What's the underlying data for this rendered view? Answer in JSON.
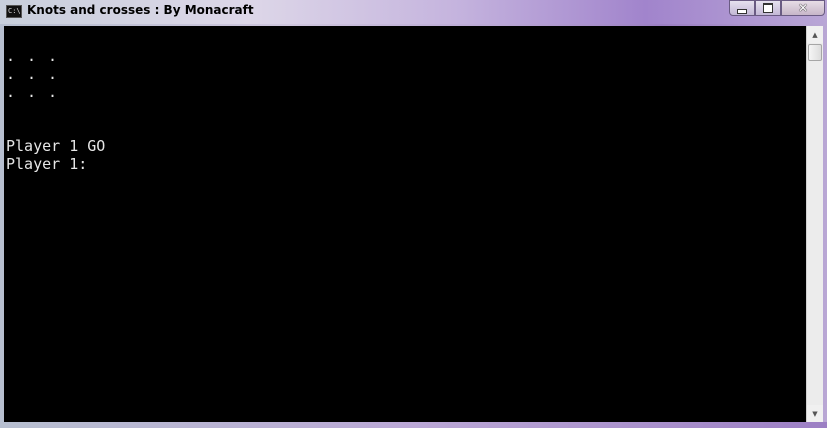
{
  "window": {
    "title": "Knots and crosses : By Monacraft",
    "icon": "console-icon",
    "icon_text": "C:\\"
  },
  "controls": {
    "minimize_icon": "minimize-icon",
    "maximize_icon": "maximize-icon",
    "close_icon": "close-icon",
    "close_glyph": "✕"
  },
  "console": {
    "board": [
      [
        ".",
        ".",
        "."
      ],
      [
        ".",
        ".",
        "."
      ],
      [
        ".",
        ".",
        "."
      ]
    ],
    "lines": [
      "Player 1 GO",
      "Player 1:"
    ]
  },
  "scrollbar": {
    "up_glyph": "▲",
    "down_glyph": "▼"
  }
}
